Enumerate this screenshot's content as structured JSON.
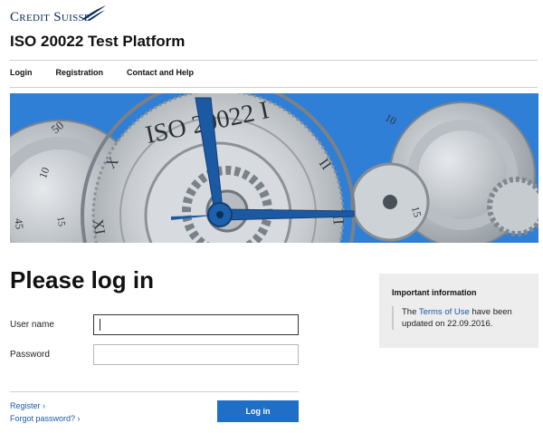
{
  "brand": {
    "name": "Credit Suisse"
  },
  "app": {
    "title": "ISO 20022 Test Platform"
  },
  "nav": [
    {
      "label": "Login"
    },
    {
      "label": "Registration"
    },
    {
      "label": "Contact and Help"
    }
  ],
  "hero": {
    "dial_text": "ISO 20022 I",
    "numerals": [
      "50",
      "10",
      "45",
      "15",
      "X",
      "XI",
      "II",
      "III",
      "10",
      "15"
    ]
  },
  "login": {
    "heading": "Please log in",
    "username_label": "User name",
    "username_value": "",
    "password_label": "Password",
    "password_value": "",
    "register_link": "Register ›",
    "forgot_link": "Forgot password? ›",
    "submit_label": "Log in"
  },
  "info": {
    "title": "Important information",
    "text_before": "The ",
    "link_text": "Terms of Use",
    "text_after": " have been updated on 22.09.2016."
  },
  "colors": {
    "brand_navy": "#0b2a5b",
    "accent_blue": "#1f6fc7",
    "link_blue": "#1a5aa8",
    "info_bg": "#ededed"
  }
}
